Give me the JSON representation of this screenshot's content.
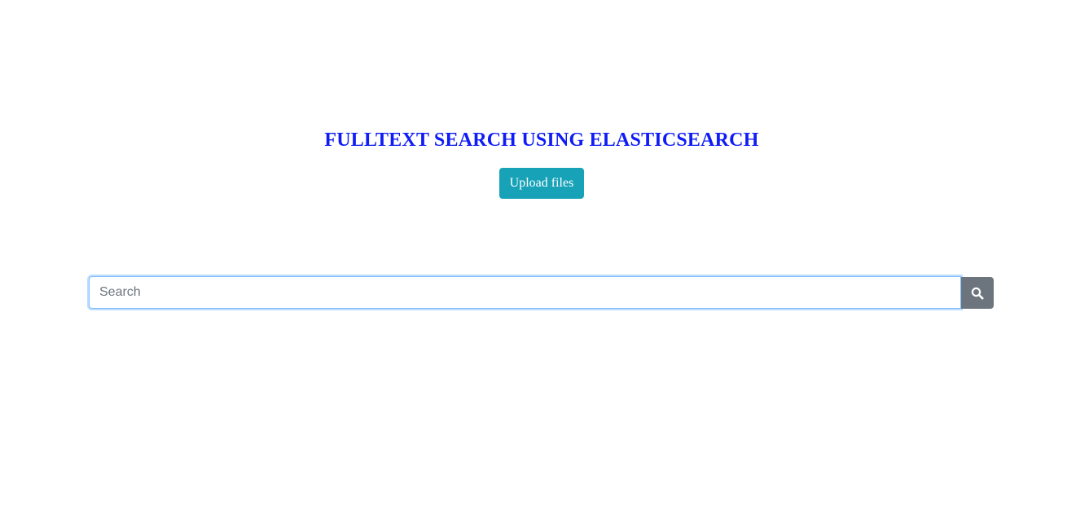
{
  "header": {
    "title": "FULLTEXT SEARCH USING ELASTICSEARCH"
  },
  "upload": {
    "label": "Upload files"
  },
  "search": {
    "value": "",
    "placeholder": "Search",
    "button_icon": "search-icon"
  },
  "colors": {
    "title": "#0f1cf5",
    "upload_button": "#17a2b8",
    "search_button": "#6c757d",
    "input_focus_border": "#80bdff"
  }
}
